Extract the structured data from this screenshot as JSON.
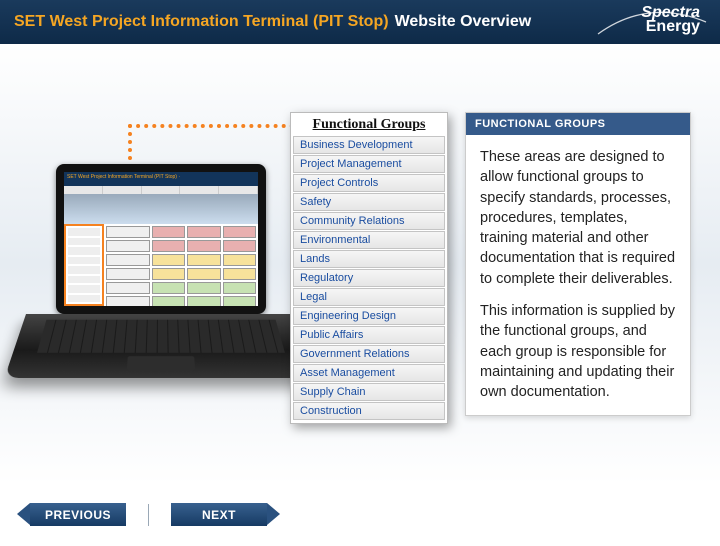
{
  "header": {
    "title_main": "SET West Project Information Terminal (PIT Stop)",
    "title_sub": "Website Overview",
    "logo_line1": "Spectra",
    "logo_line2": "Energy"
  },
  "functional_groups": {
    "title": "Functional Groups",
    "items": [
      "Business Development",
      "Project Management",
      "Project Controls",
      "Safety",
      "Community Relations",
      "Environmental",
      "Lands",
      "Regulatory",
      "Legal",
      "Engineering Design",
      "Public Affairs",
      "Government Relations",
      "Asset Management",
      "Supply Chain",
      "Construction"
    ]
  },
  "info_panel": {
    "heading": "FUNCTIONAL GROUPS",
    "para1": "These areas are designed to allow functional groups to specify standards, processes, procedures, templates, training material and other documentation that is required to complete their deliverables.",
    "para2": "This information is supplied by the functional groups, and each group is responsible for maintaining and updating their own documentation."
  },
  "nav": {
    "previous": "PREVIOUS",
    "next": "NEXT"
  },
  "laptop": {
    "mini_title": "SET West Project Information Terminal (PIT Stop) ·"
  }
}
